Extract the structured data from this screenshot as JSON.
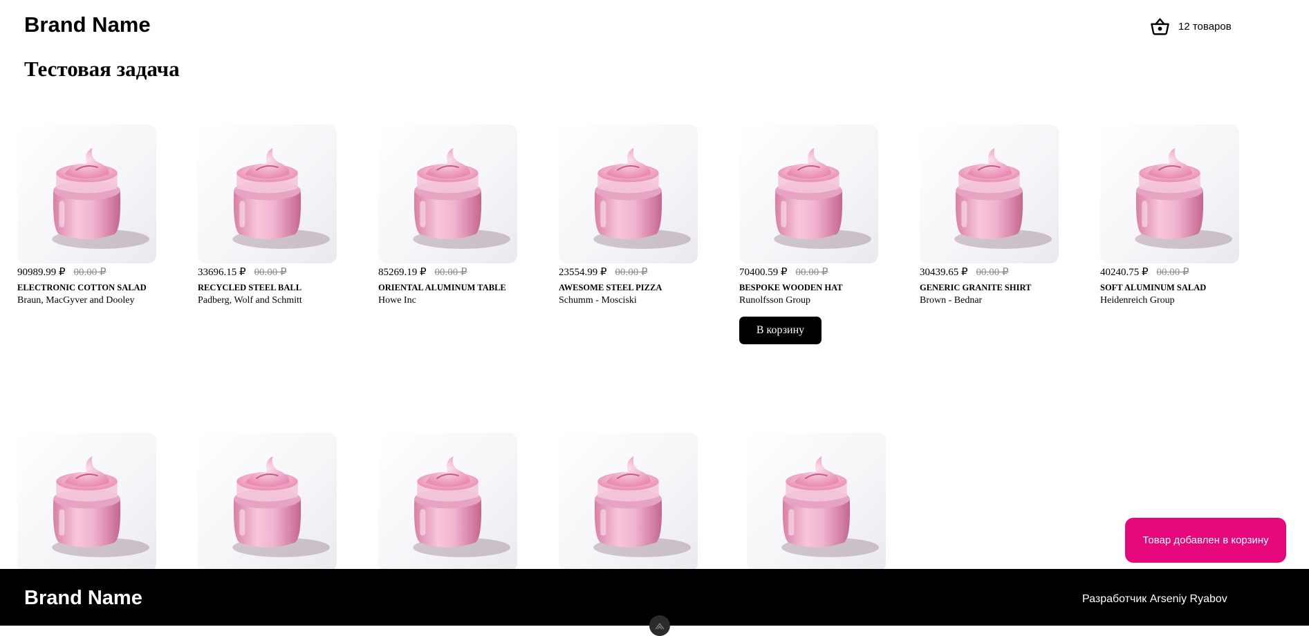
{
  "header": {
    "brand": "Brand Name",
    "cart_label": "12 товаров"
  },
  "page_title": "Тестовая задача",
  "products": [
    {
      "price": "90989.99 ₽",
      "old_price": "00.00 ₽",
      "name": "ELECTRONIC COTTON SALAD",
      "maker": "Braun, MacGyver and Dooley"
    },
    {
      "price": "33696.15 ₽",
      "old_price": "00.00 ₽",
      "name": "RECYCLED STEEL BALL",
      "maker": "Padberg, Wolf and Schmitt"
    },
    {
      "price": "85269.19 ₽",
      "old_price": "00.00 ₽",
      "name": "ORIENTAL ALUMINUM TABLE",
      "maker": "Howe Inc"
    },
    {
      "price": "23554.99 ₽",
      "old_price": "00.00 ₽",
      "name": "AWESOME STEEL PIZZA",
      "maker": "Schumm - Mosciski"
    },
    {
      "price": "70400.59 ₽",
      "old_price": "00.00 ₽",
      "name": "BESPOKE WOODEN HAT",
      "maker": "Runolfsson Group",
      "button": "В корзину"
    },
    {
      "price": "30439.65 ₽",
      "old_price": "00.00 ₽",
      "name": "GENERIC GRANITE SHIRT",
      "maker": "Brown - Bednar"
    },
    {
      "price": "40240.75 ₽",
      "old_price": "00.00 ₽",
      "name": "SOFT ALUMINUM SALAD",
      "maker": "Heidenreich Group"
    }
  ],
  "second_row_count": 5,
  "toast": "Товар добавлен в корзину",
  "footer": {
    "brand": "Brand Name",
    "developer": "Разработчик Arseniy Ryabov"
  },
  "colors": {
    "toast": "#e6077c",
    "button": "#000000",
    "footer": "#000000"
  },
  "icons": {
    "cart": "basket-icon",
    "product_image": "cream-jar-image"
  }
}
